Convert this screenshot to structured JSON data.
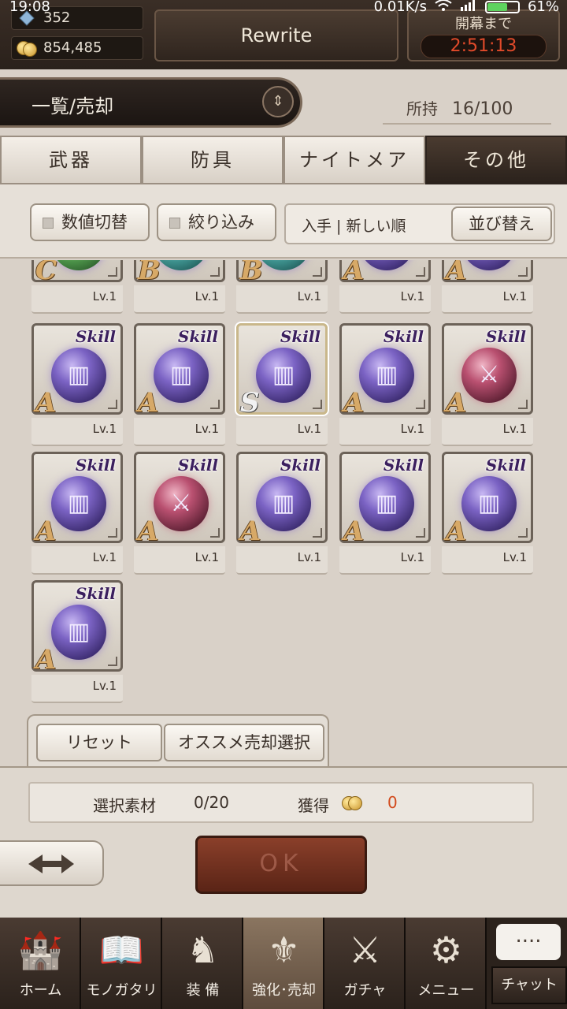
{
  "status_bar": {
    "time": "19:08",
    "net_speed": "0.01K/s",
    "battery": "61%"
  },
  "header": {
    "gems": "352",
    "gold": "854,485",
    "rewrite_label": "Rewrite",
    "timer_label": "開幕まで",
    "timer_value": "2:51:13"
  },
  "list_header": {
    "title": "一覧/売却",
    "owned_label": "所持",
    "owned_value": "16/100"
  },
  "tabs": [
    {
      "label": "武器",
      "active": false
    },
    {
      "label": "防具",
      "active": false
    },
    {
      "label": "ナイトメア",
      "active": false
    },
    {
      "label": "その他",
      "active": true
    }
  ],
  "filters": {
    "toggle_values": "数値切替",
    "narrow": "絞り込み",
    "sort_current": "入手 | 新しい順",
    "sort_button": "並び替え"
  },
  "items": [
    {
      "rank": "C",
      "skill": "",
      "level": "Lv.1",
      "orb": "green"
    },
    {
      "rank": "B",
      "skill": "",
      "level": "Lv.1",
      "orb": "teal"
    },
    {
      "rank": "B",
      "skill": "",
      "level": "Lv.1",
      "orb": "teal"
    },
    {
      "rank": "A",
      "skill": "",
      "level": "Lv.1",
      "orb": "purple"
    },
    {
      "rank": "A",
      "skill": "",
      "level": "Lv.1",
      "orb": "purple"
    },
    {
      "rank": "A",
      "skill": "Skill",
      "level": "Lv.1",
      "orb": "purple",
      "glyph": "book"
    },
    {
      "rank": "A",
      "skill": "Skill",
      "level": "Lv.1",
      "orb": "purple",
      "glyph": "book"
    },
    {
      "rank": "S",
      "skill": "Skill",
      "level": "Lv.1",
      "orb": "purple",
      "glyph": "book",
      "selected": true
    },
    {
      "rank": "A",
      "skill": "Skill",
      "level": "Lv.1",
      "orb": "purple",
      "glyph": "book"
    },
    {
      "rank": "A",
      "skill": "Skill",
      "level": "Lv.1",
      "orb": "red",
      "glyph": "swords"
    },
    {
      "rank": "A",
      "skill": "Skill",
      "level": "Lv.1",
      "orb": "purple",
      "glyph": "book"
    },
    {
      "rank": "A",
      "skill": "Skill",
      "level": "Lv.1",
      "orb": "red",
      "glyph": "swords"
    },
    {
      "rank": "A",
      "skill": "Skill",
      "level": "Lv.1",
      "orb": "purple",
      "glyph": "book"
    },
    {
      "rank": "A",
      "skill": "Skill",
      "level": "Lv.1",
      "orb": "purple",
      "glyph": "book"
    },
    {
      "rank": "A",
      "skill": "Skill",
      "level": "Lv.1",
      "orb": "purple",
      "glyph": "book"
    },
    {
      "rank": "A",
      "skill": "Skill",
      "level": "Lv.1",
      "orb": "purple",
      "glyph": "book"
    }
  ],
  "actions": {
    "reset": "リセット",
    "recommend": "オススメ売却選択"
  },
  "summary": {
    "selected_label": "選択素材",
    "selected_value": "0/20",
    "gain_label": "獲得",
    "gain_value": "0"
  },
  "ok_label": "OK",
  "nav": [
    {
      "label": "ホーム",
      "icon": "castle-icon",
      "glyph": "🏰",
      "active": false
    },
    {
      "label": "モノガタリ",
      "icon": "book-icon",
      "glyph": "📖",
      "active": false
    },
    {
      "label": "装 備",
      "icon": "puppet-icon",
      "glyph": "♞",
      "active": false
    },
    {
      "label": "強化･売却",
      "icon": "helmet-icon",
      "glyph": "⚜",
      "active": true
    },
    {
      "label": "ガチャ",
      "icon": "swords-icon",
      "glyph": "⚔",
      "active": false
    },
    {
      "label": "メニュー",
      "icon": "gears-icon",
      "glyph": "⚙",
      "active": false
    }
  ],
  "chat": {
    "bubble": "....",
    "label": "チャット"
  },
  "colors": {
    "accent_red": "#d24a1c",
    "timer_red": "#e04a2a",
    "active_tab": "#2b221c"
  }
}
